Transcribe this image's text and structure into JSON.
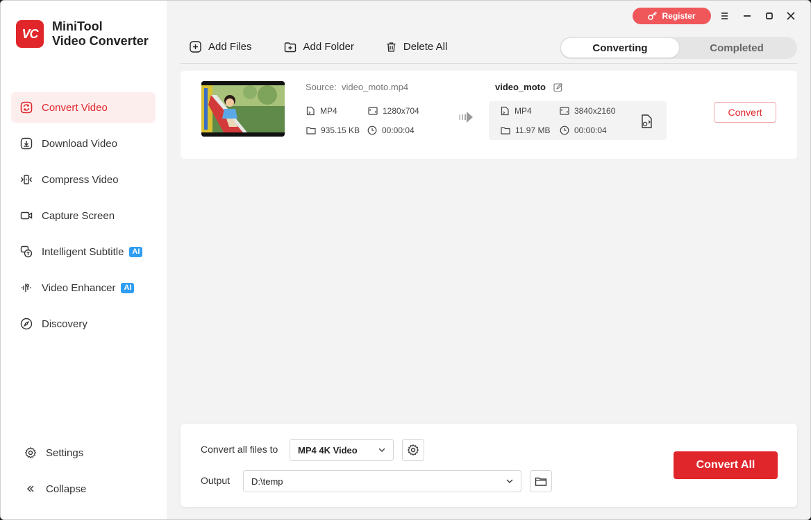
{
  "app": {
    "brand_line1": "MiniTool",
    "brand_line2": "Video Converter",
    "logo_text": "VC",
    "accent_color": "#e0262b"
  },
  "sidebar": {
    "items": [
      {
        "label": "Convert Video",
        "icon": "convert-icon",
        "active": true
      },
      {
        "label": "Download Video",
        "icon": "download-icon"
      },
      {
        "label": "Compress Video",
        "icon": "compress-icon"
      },
      {
        "label": "Capture Screen",
        "icon": "camera-icon"
      },
      {
        "label": "Intelligent Subtitle",
        "icon": "subtitle-icon",
        "badge": "AI"
      },
      {
        "label": "Video Enhancer",
        "icon": "enhancer-icon",
        "badge": "AI"
      },
      {
        "label": "Discovery",
        "icon": "compass-icon"
      }
    ],
    "settings_label": "Settings",
    "collapse_label": "Collapse"
  },
  "titlebar": {
    "register_label": "Register"
  },
  "toolbar": {
    "add_files": "Add Files",
    "add_folder": "Add Folder",
    "delete_all": "Delete All"
  },
  "tabs": {
    "converting": "Converting",
    "completed": "Completed"
  },
  "file": {
    "source_prefix": "Source:",
    "source_name": "video_moto.mp4",
    "source_format": "MP4",
    "source_resolution": "1280x704",
    "source_size": "935.15 KB",
    "source_duration": "00:00:04",
    "target_name": "video_moto",
    "target_format": "MP4",
    "target_resolution": "3840x2160",
    "target_size": "11.97 MB",
    "target_duration": "00:00:04",
    "convert_label": "Convert"
  },
  "bottom": {
    "convert_all_label": "Convert all files to",
    "format_value": "MP4 4K Video",
    "output_label": "Output",
    "output_value": "D:\\temp",
    "convert_all_button": "Convert All"
  }
}
